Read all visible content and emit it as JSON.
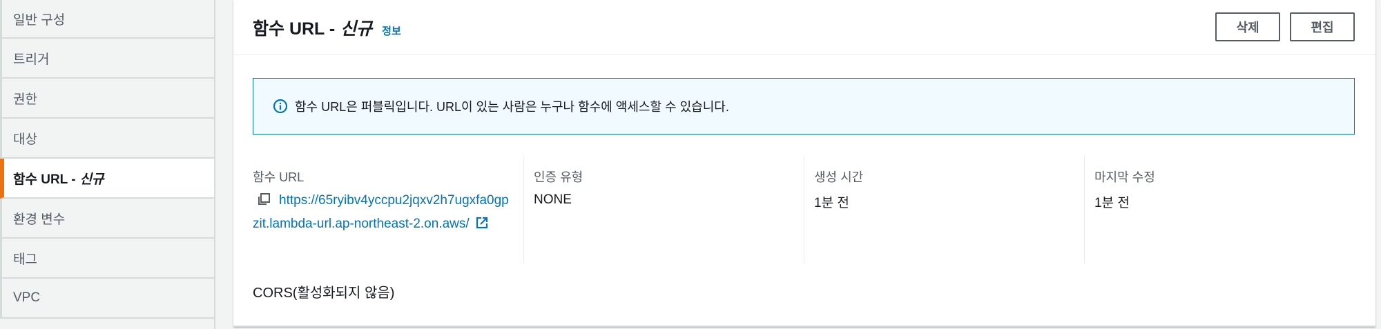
{
  "sidebar": {
    "items": [
      {
        "label": "일반 구성"
      },
      {
        "label": "트리거"
      },
      {
        "label": "권한"
      },
      {
        "label": "대상"
      },
      {
        "label": "함수 URL -",
        "tag": "신규"
      },
      {
        "label": "환경 변수"
      },
      {
        "label": "태그"
      },
      {
        "label": "VPC"
      }
    ]
  },
  "panel": {
    "title": "함수 URL -",
    "title_tag": "신규",
    "info_link": "정보",
    "delete_label": "삭제",
    "edit_label": "편집"
  },
  "alert": {
    "text": "함수 URL은 퍼블릭입니다. URL이 있는 사람은 누구나 함수에 액세스할 수 있습니다."
  },
  "details": {
    "function_url": {
      "label": "함수 URL",
      "value": "https://65ryibv4yccpu2jqxv2h7ugxfa0gpzit.lambda-url.ap-northeast-2.on.aws/"
    },
    "auth_type": {
      "label": "인증 유형",
      "value": "NONE"
    },
    "created": {
      "label": "생성 시간",
      "value": "1분 전"
    },
    "modified": {
      "label": "마지막 수정",
      "value": "1분 전"
    }
  },
  "cors": {
    "text": "CORS(활성화되지 않음)"
  },
  "colors": {
    "accent": "#ec7211",
    "link": "#0073bb",
    "alert_bg": "#f1faff"
  },
  "icons": [
    "info-icon",
    "copy-icon",
    "external-link-icon"
  ]
}
